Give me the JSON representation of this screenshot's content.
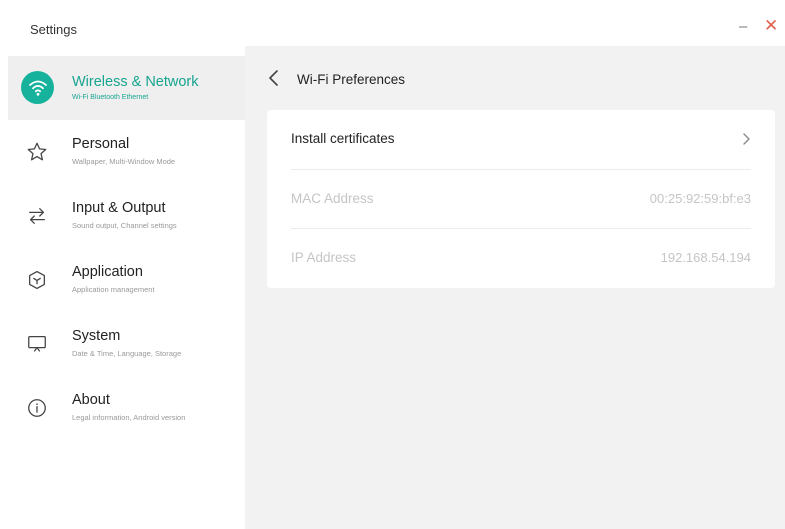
{
  "window": {
    "title": "Settings",
    "minimize_label": "–",
    "close_label": "✕"
  },
  "sidebar": {
    "items": [
      {
        "title": "Wireless & Network",
        "subtitle": "Wi-Fi Bluetooth Ethernet",
        "icon": "wifi-icon",
        "active": true
      },
      {
        "title": "Personal",
        "subtitle": "Wallpaper, Multi-Window Mode",
        "icon": "star-icon",
        "active": false
      },
      {
        "title": "Input & Output",
        "subtitle": "Sound output, Channel settings",
        "icon": "swap-arrows-icon",
        "active": false
      },
      {
        "title": "Application",
        "subtitle": "Application management",
        "icon": "cube-icon",
        "active": false
      },
      {
        "title": "System",
        "subtitle": "Date & Time, Language, Storage",
        "icon": "monitor-icon",
        "active": false
      },
      {
        "title": "About",
        "subtitle": "Legal information, Android version",
        "icon": "info-icon",
        "active": false
      }
    ]
  },
  "content": {
    "title": "Wi-Fi Preferences",
    "rows": [
      {
        "label": "Install certificates",
        "value": "",
        "enabled": true,
        "icon": "chevron-right-icon"
      },
      {
        "label": "MAC Address",
        "value": "00:25:92:59:bf:e3",
        "enabled": false
      },
      {
        "label": "IP Address",
        "value": "192.168.54.194",
        "enabled": false
      }
    ]
  },
  "colors": {
    "accent": "#16b29c",
    "sidebar_active_bg": "#efefef",
    "content_bg": "#f2f2f2",
    "close": "#e0604f"
  }
}
